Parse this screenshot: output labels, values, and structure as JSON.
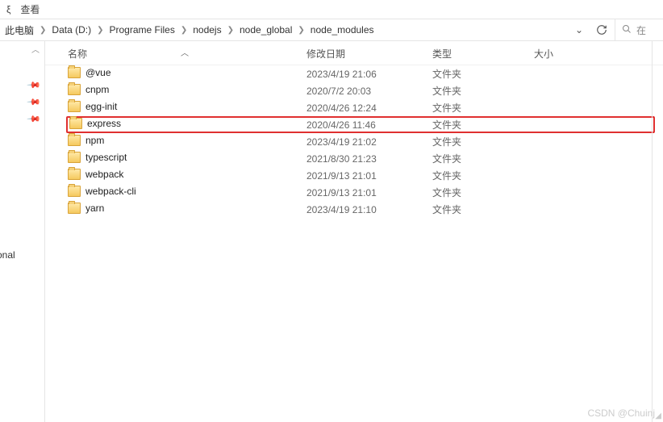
{
  "toolbar": {
    "item1": "ξ",
    "item2": "查看"
  },
  "breadcrumb": {
    "items": [
      "此电脑",
      "Data (D:)",
      "Programe Files",
      "nodejs",
      "node_global",
      "node_modules"
    ],
    "search_prefix": "在"
  },
  "sidebar": {
    "label_partial": "onal"
  },
  "columns": {
    "name": "名称",
    "modified": "修改日期",
    "type": "类型",
    "size": "大小"
  },
  "rows": [
    {
      "name": "@vue",
      "modified": "2023/4/19 21:06",
      "type": "文件夹",
      "highlight": false
    },
    {
      "name": "cnpm",
      "modified": "2020/7/2 20:03",
      "type": "文件夹",
      "highlight": false
    },
    {
      "name": "egg-init",
      "modified": "2020/4/26 12:24",
      "type": "文件夹",
      "highlight": false
    },
    {
      "name": "express",
      "modified": "2020/4/26 11:46",
      "type": "文件夹",
      "highlight": true
    },
    {
      "name": "npm",
      "modified": "2023/4/19 21:02",
      "type": "文件夹",
      "highlight": false
    },
    {
      "name": "typescript",
      "modified": "2021/8/30 21:23",
      "type": "文件夹",
      "highlight": false
    },
    {
      "name": "webpack",
      "modified": "2021/9/13 21:01",
      "type": "文件夹",
      "highlight": false
    },
    {
      "name": "webpack-cli",
      "modified": "2021/9/13 21:01",
      "type": "文件夹",
      "highlight": false
    },
    {
      "name": "yarn",
      "modified": "2023/4/19 21:10",
      "type": "文件夹",
      "highlight": false
    }
  ],
  "watermark": "CSDN @Chuinj"
}
